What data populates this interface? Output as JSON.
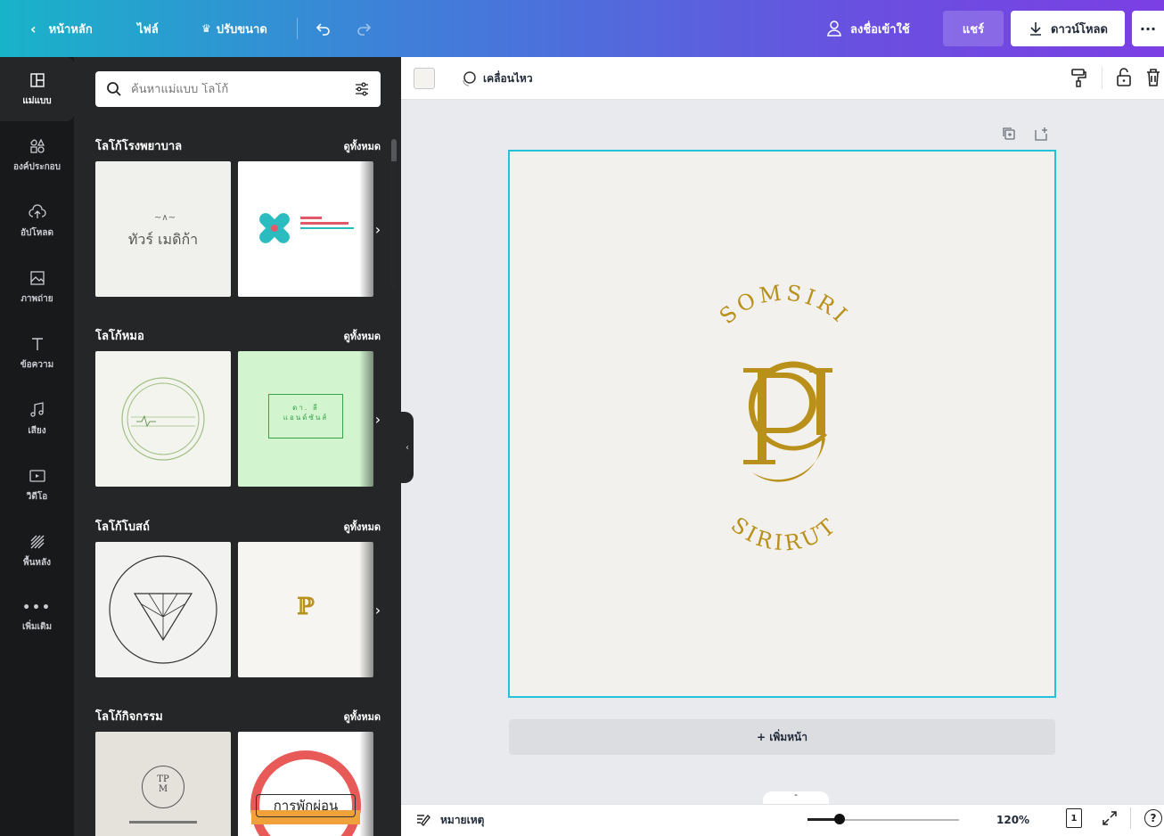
{
  "topbar": {
    "home": "หน้าหลัก",
    "file": "ไฟล์",
    "resize": "ปรับขนาด",
    "signin": "ลงชื่อเข้าใช้",
    "share": "แชร์",
    "download": "ดาวน์โหลด",
    "more": "···"
  },
  "rail": [
    {
      "label": "แม่แบบ",
      "icon": "template-icon"
    },
    {
      "label": "องค์ประกอบ",
      "icon": "elements-icon"
    },
    {
      "label": "อัปโหลด",
      "icon": "upload-icon"
    },
    {
      "label": "ภาพถ่าย",
      "icon": "photo-icon"
    },
    {
      "label": "ข้อความ",
      "icon": "text-icon"
    },
    {
      "label": "เสียง",
      "icon": "music-icon"
    },
    {
      "label": "วิดีโอ",
      "icon": "video-icon"
    },
    {
      "label": "พื้นหลัง",
      "icon": "background-icon"
    },
    {
      "label": "เพิ่มเติม",
      "icon": "more-icon"
    }
  ],
  "search": {
    "placeholder": "ค้นหาแม่แบบ โลโก้"
  },
  "sections": [
    {
      "title": "โลโก้โรงพยาบาล",
      "see_all": "ดูทั้งหมด"
    },
    {
      "title": "โลโก้หมอ",
      "see_all": "ดูทั้งหมด"
    },
    {
      "title": "โลโก้โบสถ์",
      "see_all": "ดูทั้งหมด"
    },
    {
      "title": "โลโก้กิจกรรม",
      "see_all": "ดูทั้งหมด"
    }
  ],
  "thumbs": {
    "t1": "ทัวร์ เมดิก้า",
    "t4": "ดา. ลี\nแอนด์ซันส์",
    "t7": "TP\nM",
    "t8": "การพักผ่อน"
  },
  "toolbar": {
    "animate": "เคลื่อนไหว"
  },
  "logo": {
    "top": "SOMSIRI",
    "bottom": "SIRIRUT",
    "monogram": "PC",
    "color": "#b8901a"
  },
  "canvas": {
    "add_page": "+ เพิ่มหน้า",
    "border_color": "#22c3d8"
  },
  "bottombar": {
    "notes": "หมายเหตุ",
    "zoom": "120%",
    "page_num": "1",
    "help": "?"
  }
}
